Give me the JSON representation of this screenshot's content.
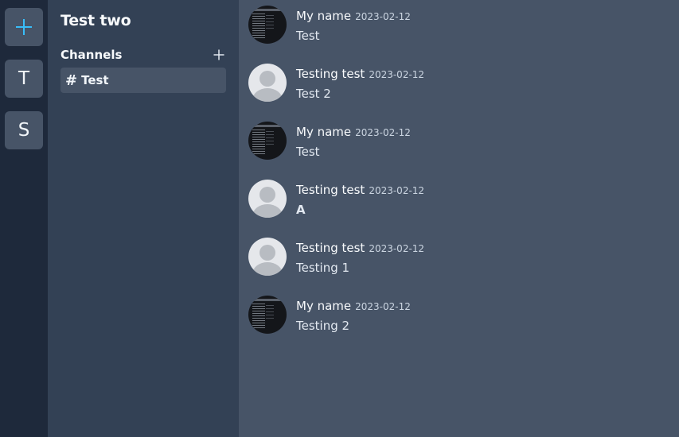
{
  "rail": {
    "add_icon": "plus-icon",
    "servers": [
      {
        "letter": "T"
      },
      {
        "letter": "S"
      }
    ]
  },
  "sidebar": {
    "server_name": "Test two",
    "channels_label": "Channels",
    "add_channel_icon": "plus-icon",
    "channels": [
      {
        "hash": "#",
        "name": "Test"
      }
    ]
  },
  "messages": [
    {
      "author": "My name",
      "date": "2023-02-12",
      "text": "Test",
      "avatar": "photo"
    },
    {
      "author": "Testing test",
      "date": "2023-02-12",
      "text": "Test 2",
      "avatar": "default"
    },
    {
      "author": "My name",
      "date": "2023-02-12",
      "text": "Test",
      "avatar": "photo"
    },
    {
      "author": "Testing test",
      "date": "2023-02-12",
      "text": "A",
      "avatar": "default",
      "bold": true
    },
    {
      "author": "Testing test",
      "date": "2023-02-12",
      "text": "Testing 1",
      "avatar": "default"
    },
    {
      "author": "My name",
      "date": "2023-02-12",
      "text": "Testing 2",
      "avatar": "photo"
    }
  ],
  "colors": {
    "rail_bg": "#1e293b",
    "sidebar_bg": "#334155",
    "main_bg": "#475467",
    "accent": "#38bdf8"
  }
}
